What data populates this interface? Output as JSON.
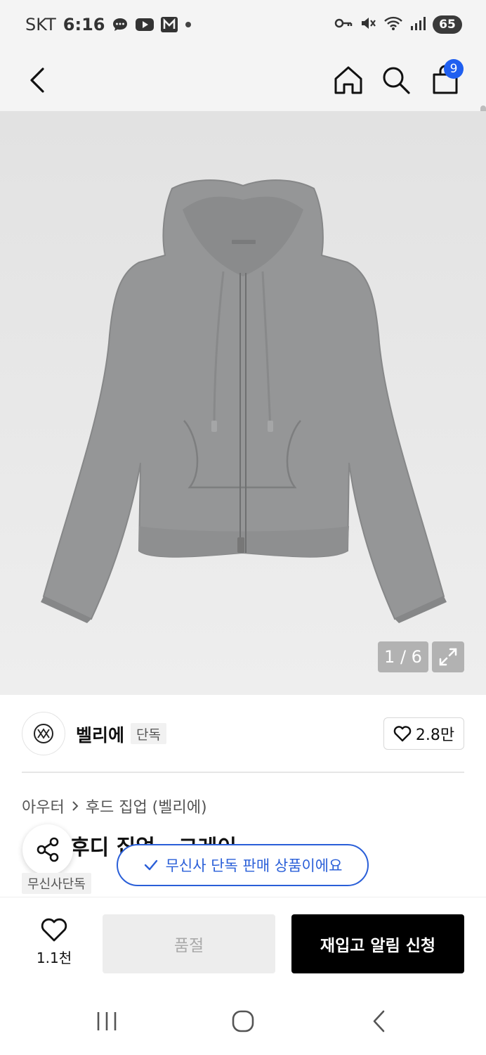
{
  "status_bar": {
    "carrier": "SKT",
    "time": "6:16",
    "battery": "65"
  },
  "header": {
    "cart_count": "9",
    "accent_color": "#1f5ff0"
  },
  "gallery": {
    "counter": "1 / 6"
  },
  "brand": {
    "name": "벨리에",
    "tag": "단독",
    "likes": "2.8만"
  },
  "product": {
    "breadcrumb": [
      "아우터",
      "후드 집업 (벨리에)"
    ],
    "title_partial": "후디 집업 - 그레이",
    "tag": "무신사단독"
  },
  "toast": {
    "text": "무신사 단독 판매 상품이에요",
    "color": "#2a5fd8"
  },
  "bottom_bar": {
    "wish_count": "1.1천",
    "soldout_label": "품절",
    "restock_label": "재입고 알림 신청"
  },
  "icons": [
    "back-icon",
    "home-icon",
    "search-icon",
    "cart-icon",
    "expand-icon",
    "heart-icon",
    "share-icon",
    "check-icon"
  ]
}
